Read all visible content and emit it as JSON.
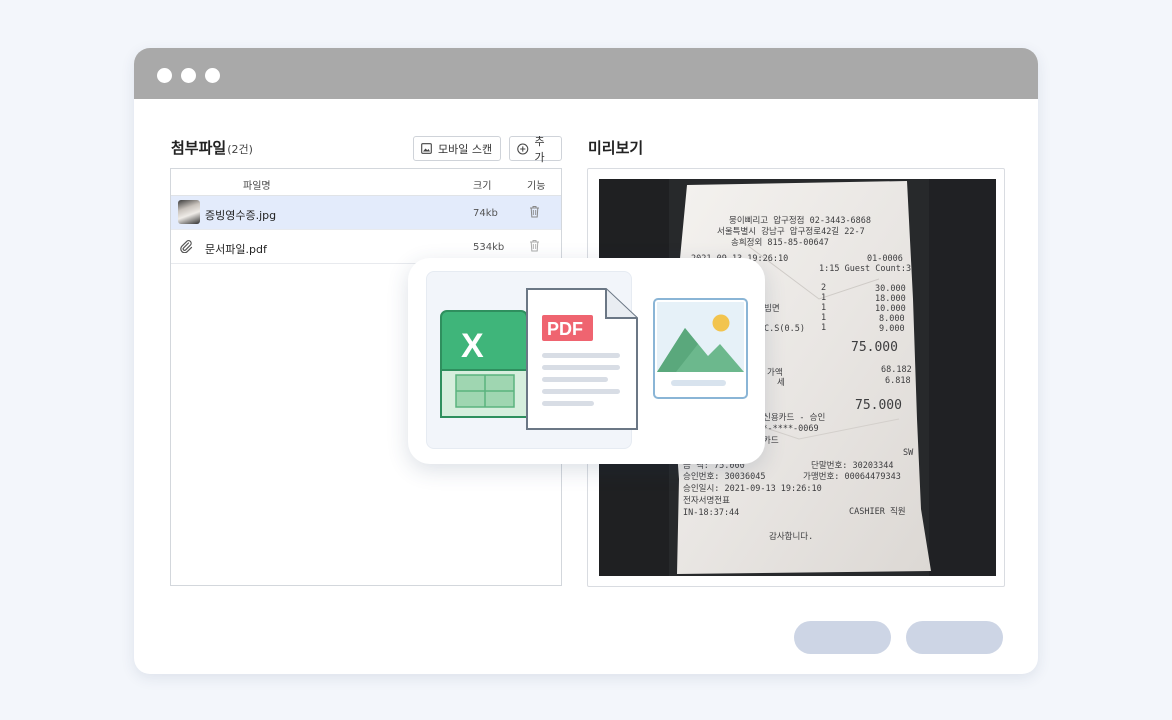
{
  "attachments": {
    "title": "첨부파일",
    "count": "(2건)",
    "scan_button": "모바일 스캔",
    "add_button": "추가",
    "columns": {
      "name": "파일명",
      "size": "크기",
      "action": "기능"
    },
    "files": [
      {
        "name": "증빙영수증.jpg",
        "size": "74kb",
        "selected": true,
        "icon": "image-thumbnail"
      },
      {
        "name": "문서파일.pdf",
        "size": "534kb",
        "selected": false,
        "icon": "paperclip-icon"
      }
    ]
  },
  "preview": {
    "title": "미리보기",
    "receipt": {
      "header": [
        "뭉이삐리고 압구정점 02-3443-6868",
        "서울특별시 강남구 압구정로42길 22-7",
        "송희정외   815-85-00647"
      ],
      "date_row": "2021-09-13 19:26:10",
      "table_row": "1:15  Guest Count:3",
      "order_no": "01-0006",
      "items": [
        {
          "name": "",
          "qty": "2",
          "amount": "30.000"
        },
        {
          "name": "빔면",
          "qty": "1",
          "amount": "18.000"
        },
        {
          "name": "",
          "qty": "1",
          "amount": "10.000"
        },
        {
          "name": "",
          "qty": "1",
          "amount": "8.000"
        },
        {
          "name": "C.S(0.5)",
          "qty": "1",
          "amount": "9.000"
        }
      ],
      "subtotal": "75.000",
      "supply_label": "가액",
      "supply_value": "68.182",
      "tax_label": "세",
      "tax_value": "6.818",
      "total": "75.000",
      "card_line": "신용카드 - 승인",
      "card_no": "****-****-0069",
      "card_label": "카드",
      "installment": "SW",
      "approval_amount": "금   액: 75.000",
      "terminal": "단말번호: 30203344",
      "approval_no": "승인번호: 30036045",
      "merchant_no": "가맹번호: 00064479343",
      "approval_time": "승인일시: 2021-09-13 19:26:10",
      "signature": "전자서명전표",
      "in_time": "IN-18:37:44",
      "cashier": "CASHIER   직원",
      "thanks": "감사합니다."
    }
  },
  "overlay": {
    "excel_letter": "X",
    "pdf_label": "PDF"
  },
  "colors": {
    "selected_row": "#e3ebfb",
    "footer_button": "#cdd5e5",
    "excel_green": "#3fb57a",
    "pdf_red": "#ef6470",
    "image_blue": "#8ab5d6"
  }
}
